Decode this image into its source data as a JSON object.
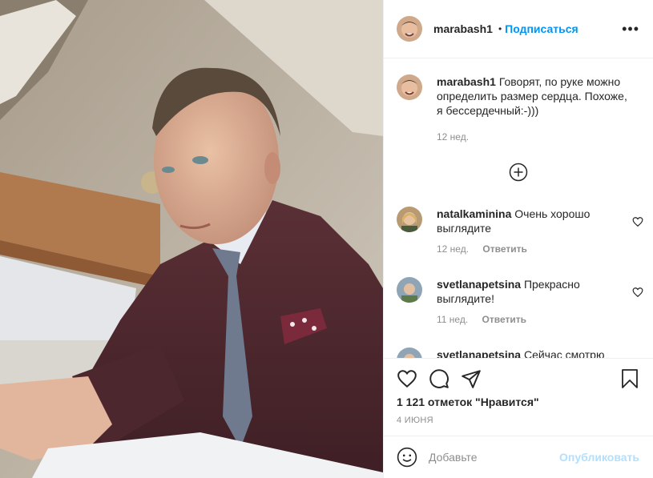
{
  "post": {
    "image_description_name": "post-photo"
  },
  "header": {
    "username": "marabash1",
    "dot": "•",
    "follow_label": "Подписаться",
    "more_label": "•••"
  },
  "caption": {
    "username": "marabash1",
    "text": " Говорят, по руке можно определить размер сердца. Похоже, я бессердечный:-)))",
    "time": "12 нед."
  },
  "comments": [
    {
      "username": "natalkaminina",
      "text": " Очень хорошо выглядите",
      "time": "12 нед.",
      "reply_label": "Ответить"
    },
    {
      "username": "svetlanapetsina",
      "text": " Прекрасно выглядите!",
      "time": "11 нед.",
      "reply_label": "Ответить"
    },
    {
      "username": "svetlanapetsina",
      "text": " Сейчас смотрю",
      "time": "",
      "reply_label": ""
    }
  ],
  "actions": {
    "likes_text": "1 121 отметок \"Нравится\"",
    "date": "4 ИЮНЯ"
  },
  "add_comment": {
    "placeholder": "Добавьте",
    "publish_label": "Опубликовать"
  },
  "colors": {
    "accent": "#0095f6",
    "publish_disabled": "#b2dffc",
    "secondary_text": "#8e8e8e",
    "border": "#efefef"
  }
}
